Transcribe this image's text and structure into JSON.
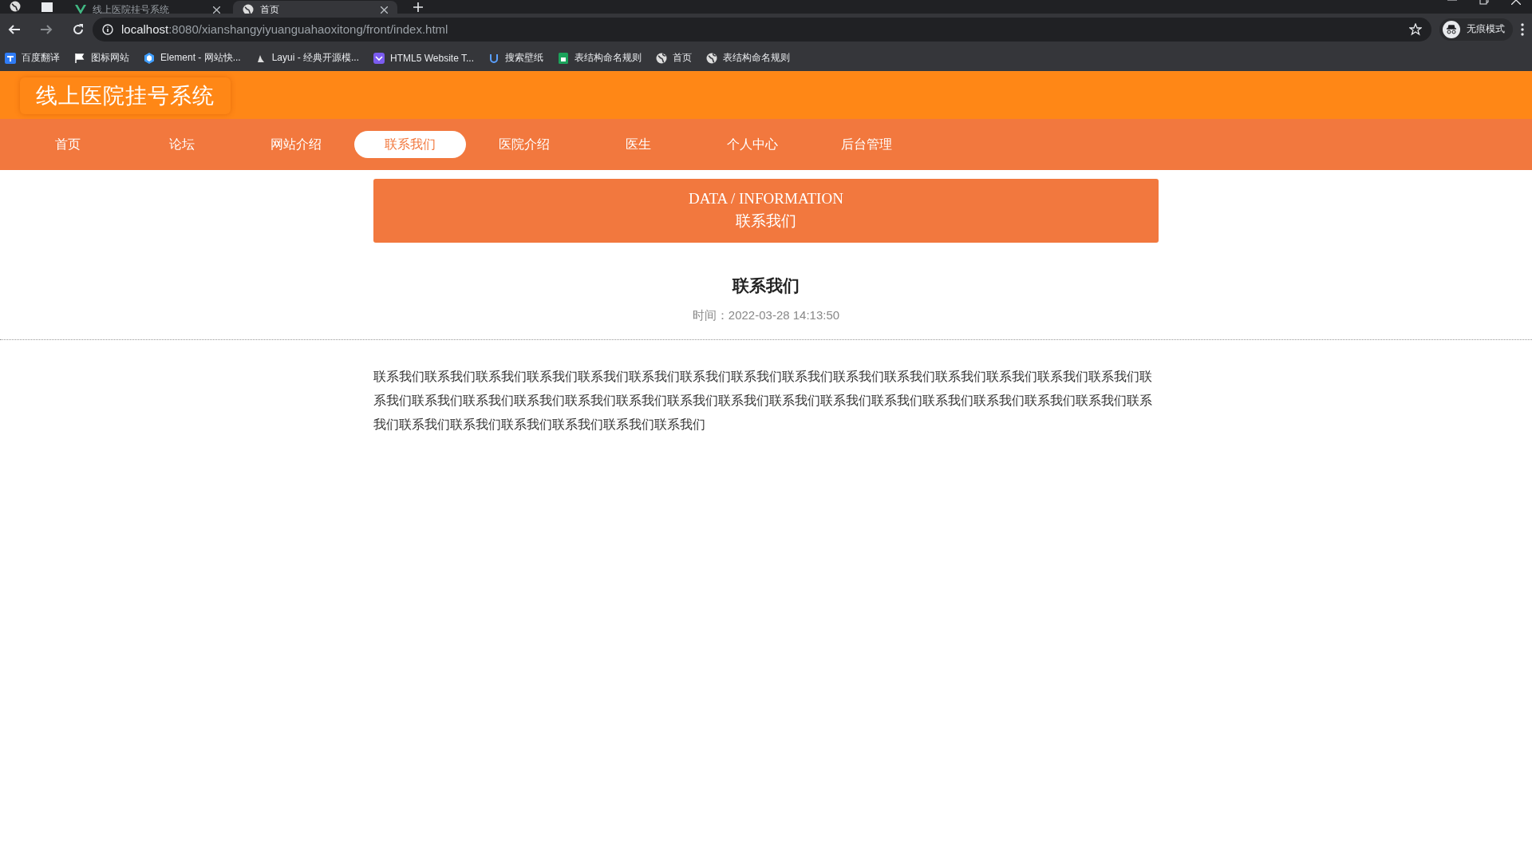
{
  "browser": {
    "tabs": [
      {
        "title": "线上医院挂号系统",
        "selected": false
      },
      {
        "title": "首页",
        "selected": true
      }
    ],
    "address": {
      "host": "localhost",
      "rest": ":8080/xianshangyiyuanguahaoxitong/front/index.html"
    },
    "profile": "无痕模式",
    "bookmarks": [
      "百度翻译",
      "图标网站",
      "Element - 网站快...",
      "Layui - 经典开源模...",
      "HTML5 Website T...",
      "搜索壁纸",
      "表结构命名规则",
      "首页",
      "表结构命名规则"
    ]
  },
  "site": {
    "title": "线上医院挂号系统"
  },
  "nav": [
    {
      "label": "首页",
      "selected": false
    },
    {
      "label": "论坛",
      "selected": false
    },
    {
      "label": "网站介绍",
      "selected": false
    },
    {
      "label": "联系我们",
      "selected": true
    },
    {
      "label": "医院介绍",
      "selected": false
    },
    {
      "label": "医生",
      "selected": false
    },
    {
      "label": "个人中心",
      "selected": false
    },
    {
      "label": "后台管理",
      "selected": false
    }
  ],
  "banner": {
    "eyebrow": "DATA / INFORMATION",
    "title": "联系我们"
  },
  "article": {
    "title": "联系我们",
    "time": "时间：2022-03-28 14:13:50",
    "body": "联系我们联系我们联系我们联系我们联系我们联系我们联系我们联系我们联系我们联系我们联系我们联系我们联系我们联系我们联系我们联系我们联系我们联系我们联系我们联系我们联系我们联系我们联系我们联系我们联系我们联系我们联系我们联系我们联系我们联系我们联系我们联系我们联系我们联系我们联系我们联系我们联系我们"
  }
}
